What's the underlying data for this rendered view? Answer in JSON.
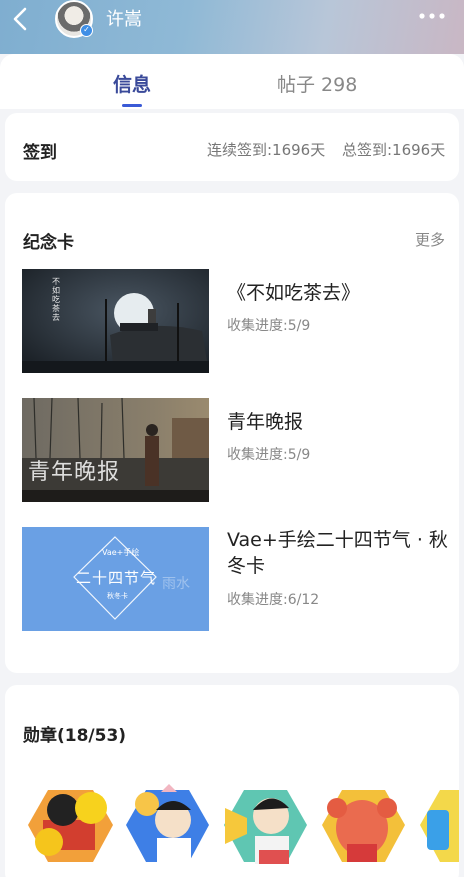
{
  "header": {
    "username": "许嵩",
    "verified_icon": "v-badge-icon",
    "back_icon": "chevron-left-icon",
    "more_icon": "more-dots-icon"
  },
  "tabs": [
    {
      "label": "信息",
      "active": true
    },
    {
      "label": "帖子 298",
      "active": false
    }
  ],
  "checkin": {
    "title": "签到",
    "streak": "连续签到:1696天",
    "total": "总签到:1696天"
  },
  "memorial_cards": {
    "title": "纪念卡",
    "more_label": "更多",
    "items": [
      {
        "name": "《不如吃茶去》",
        "progress": "收集进度:5/9",
        "thumb_text": "不如吃茶去"
      },
      {
        "name": "青年晚报",
        "progress": "收集进度:5/9",
        "thumb_text": "青年晚报"
      },
      {
        "name": "Vae+手绘二十四节气 · 秋冬卡",
        "progress": "收集进度:6/12",
        "thumb_text": {
          "brand": "Vae+手绘",
          "main": "二十四节气",
          "sub": "秋冬卡",
          "right": "雨水"
        }
      }
    ]
  },
  "medals": {
    "title": "勋章(18/53)",
    "items": [
      "medal-lemon-icon",
      "medal-balloon-boy-icon",
      "medal-megaphone-boy-icon",
      "medal-muscle-icon",
      "medal-blue-partial-icon"
    ]
  },
  "colors": {
    "accent": "#3a5ad6",
    "active_tab_text": "#3a4a9a",
    "muted_text": "#888888",
    "page_bg": "#f3f4f7"
  }
}
